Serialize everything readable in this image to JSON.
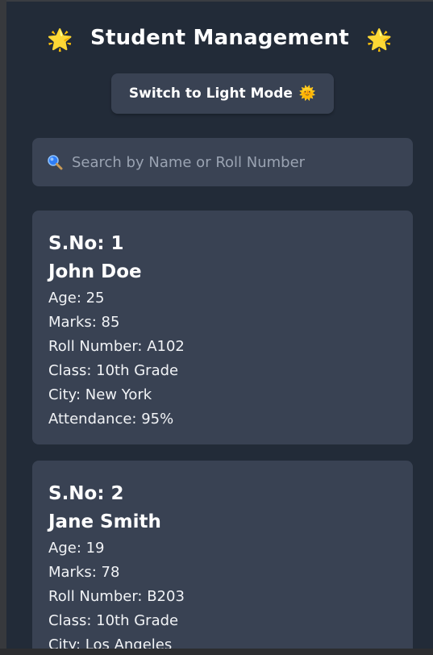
{
  "header": {
    "title": "Student Management",
    "sun_emoji": "🌟",
    "theme_button_label": "Switch to Light Mode",
    "theme_button_emoji": "🌞"
  },
  "search": {
    "placeholder": "Search by Name or Roll Number",
    "value": ""
  },
  "students": [
    {
      "sno": "S.No: 1",
      "name": "John Doe",
      "age": "Age: 25",
      "marks": "Marks: 85",
      "roll": "Roll Number: A102",
      "class": "Class: 10th Grade",
      "city": "City: New York",
      "attendance": "Attendance: 95%"
    },
    {
      "sno": "S.No: 2",
      "name": "Jane Smith",
      "age": "Age: 19",
      "marks": "Marks: 78",
      "roll": "Roll Number: B203",
      "class": "Class: 10th Grade",
      "city": "City: Los Angeles"
    }
  ],
  "colors": {
    "app_background": "#222b38",
    "card_background": "#394253",
    "text": "#ffffff",
    "placeholder": "#9aa3b2"
  }
}
